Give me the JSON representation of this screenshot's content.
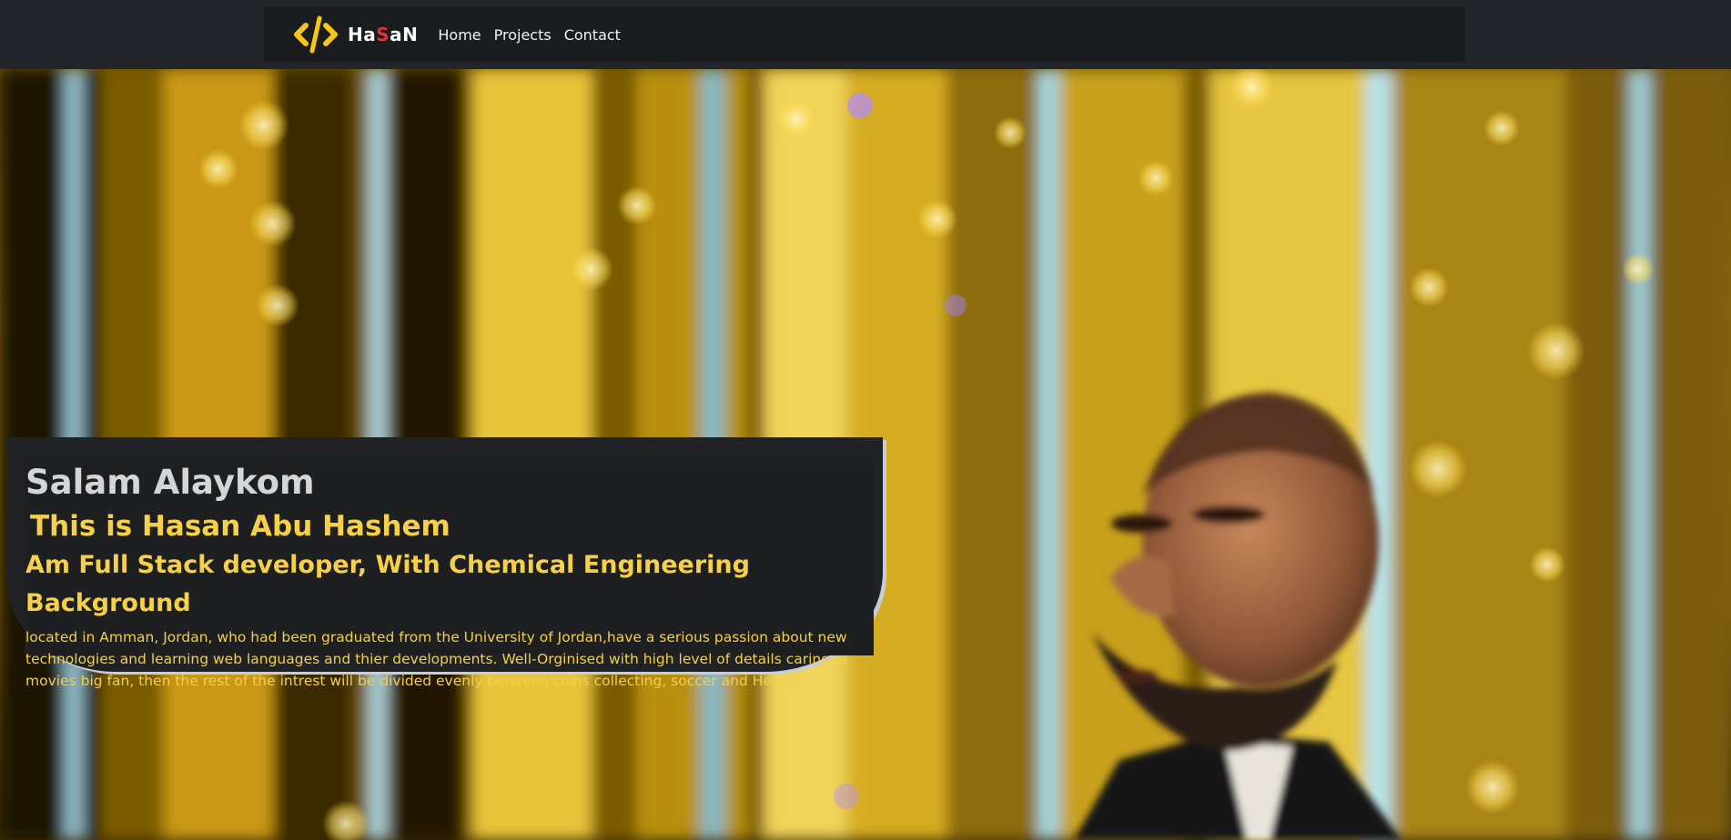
{
  "brand": {
    "logo_icon": "code-brackets-icon",
    "name_prefix": "Ha",
    "name_accent": "S",
    "name_suffix": "aN",
    "accent_color": "#f5c518",
    "accent_letter_color": "#e0343a"
  },
  "nav": {
    "items": [
      {
        "label": "Home"
      },
      {
        "label": "Projects"
      },
      {
        "label": "Contact"
      }
    ]
  },
  "hero": {
    "background_photo": "portrait-photo-with-golden-bokeh",
    "greeting": "Salam Alaykom",
    "name_line": "This is Hasan Abu Hashem",
    "role_line": "Am Full Stack developer, With Chemical Engineering Background",
    "bio": "located in Amman, Jordan, who had been graduated from the University of Jordan,have a serious passion about new technologies and learning web languages and thier developments. Well-Orginised with high level of details caring, a movies big fan, then the rest of the intrest will be divided evenly between coins collecting, soccer and Health."
  },
  "colors": {
    "navbar_bg": "#1b1c1d",
    "panel_bg": "#1e1f21",
    "heading_gray": "#d5d5d5",
    "text_yellow": "#f7d04a"
  }
}
